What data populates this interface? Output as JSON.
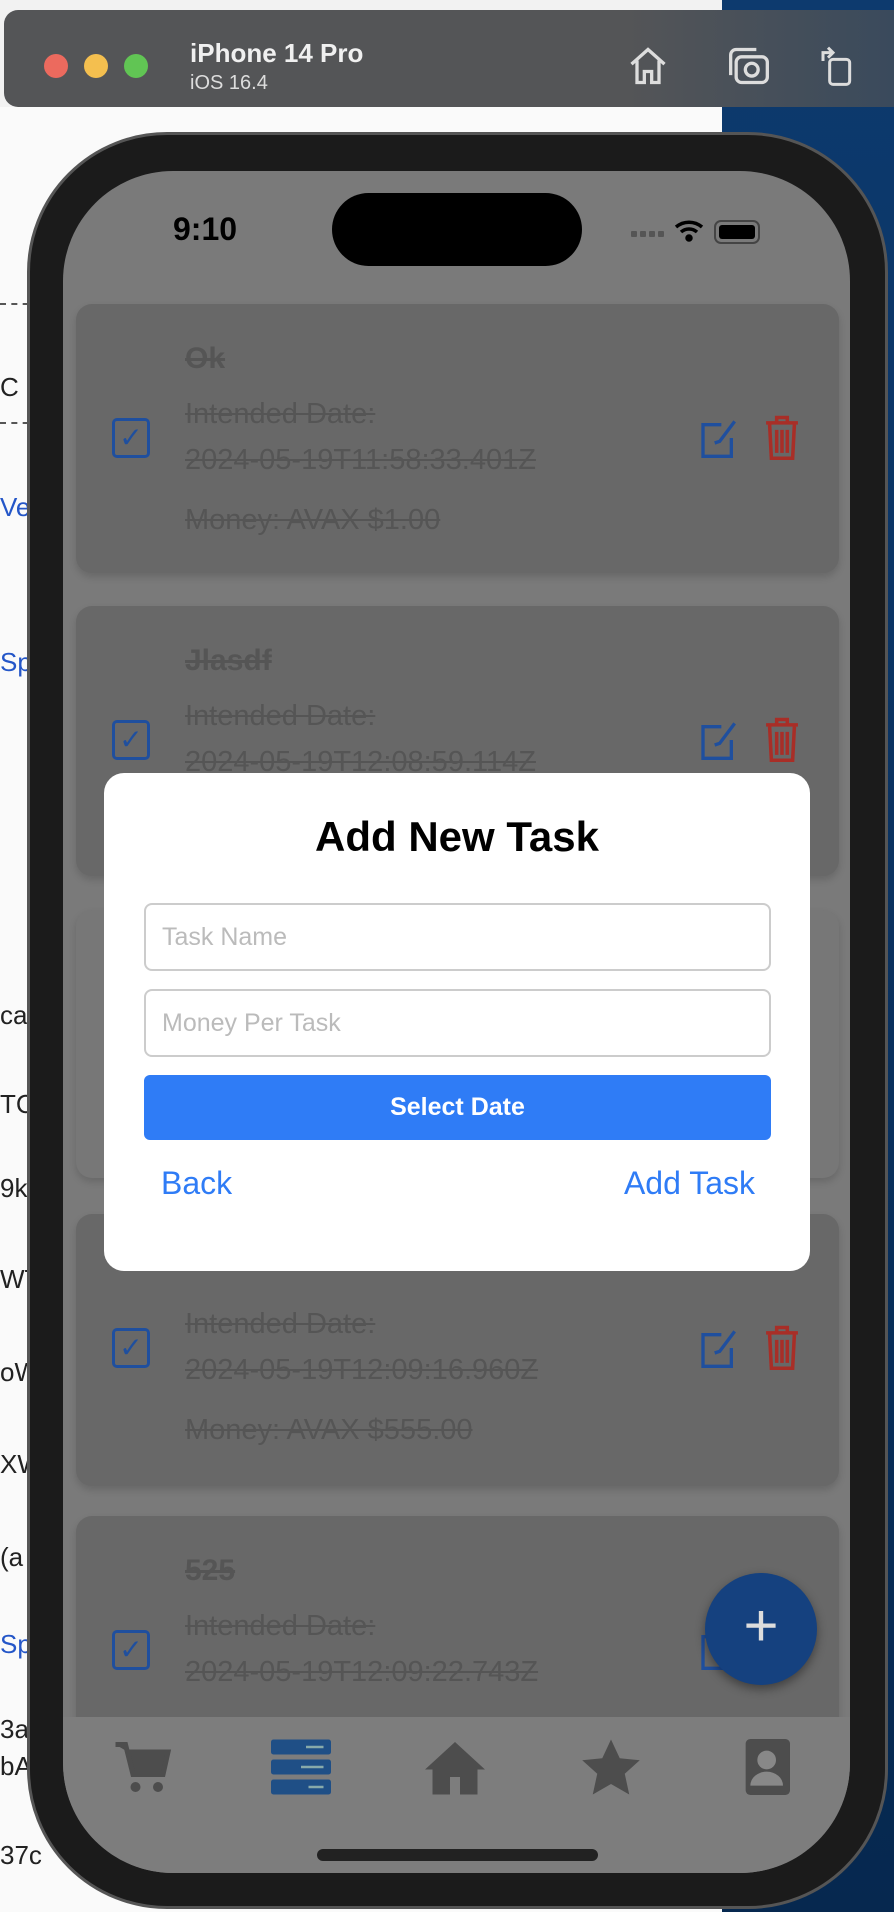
{
  "simulator": {
    "device": "iPhone 14 Pro",
    "os": "iOS 16.4",
    "icons": [
      "home-icon",
      "screenshot-icon",
      "rotate-icon"
    ]
  },
  "background_fragments": [
    "C",
    "Ve",
    "Sp",
    "ca",
    "TC",
    "9k",
    "WT",
    "oW",
    "XW",
    "(a",
    "Spl",
    "3a",
    "bA",
    "37c"
  ],
  "status_bar": {
    "time": "9:10"
  },
  "tasks": [
    {
      "title": "Ok",
      "date_label": "Intended Date:",
      "date": "2024-05-19T11:58:33.401Z",
      "money": "Money: AVAX $1.00",
      "completed": true
    },
    {
      "title": "Jlasdf",
      "date_label": "Intended Date:",
      "date": "2024-05-19T12:08:59.114Z",
      "completed": true
    },
    {
      "completed": true
    },
    {
      "date_label": "Intended Date:",
      "date": "2024-05-19T12:09:16.960Z",
      "money": "Money: AVAX $555.00",
      "completed": true
    },
    {
      "title": "525",
      "date_label": "Intended Date:",
      "date": "2024-05-19T12:09:22.743Z",
      "completed": true
    }
  ],
  "modal": {
    "title": "Add New Task",
    "task_name_placeholder": "Task Name",
    "money_placeholder": "Money Per Task",
    "select_date": "Select Date",
    "back": "Back",
    "add_task": "Add Task"
  },
  "fab": {
    "label": "+"
  },
  "tabbar": {
    "items": [
      "cart-icon",
      "tasks-icon",
      "home-icon",
      "star-icon",
      "contacts-icon"
    ],
    "active": 1
  },
  "colors": {
    "accent": "#2f7cf6",
    "danger": "#c0392b",
    "fab": "#15417f"
  }
}
